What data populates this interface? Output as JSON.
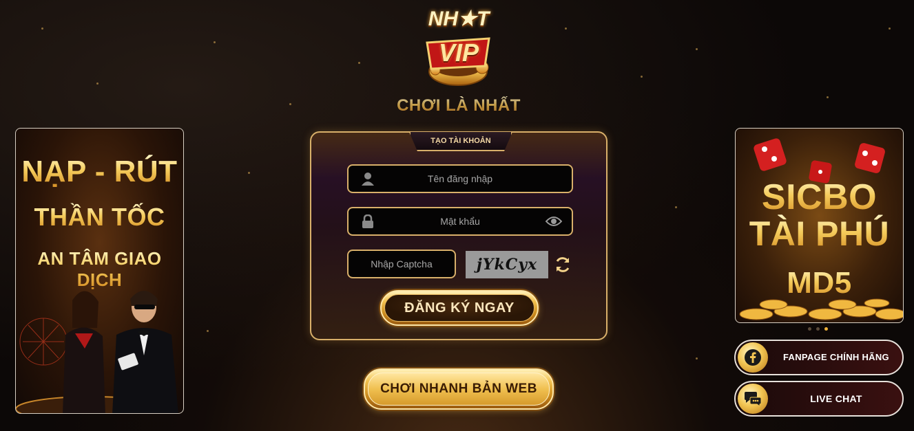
{
  "brand": {
    "logo_text_top": "NH★T",
    "logo_text_bottom": "VIP",
    "tagline": "CHƠI LÀ NHẤT"
  },
  "banner_left": {
    "line1": "NẠP - RÚT",
    "line2": "THẦN TỐC",
    "line3": "AN TÂM GIAO DỊCH"
  },
  "banner_right": {
    "line1": "SICBO",
    "line2": "TÀI PHÚ",
    "line3": "MD5"
  },
  "carousel": {
    "total": 3,
    "active": 3
  },
  "register": {
    "tab_label": "TẠO TÀI KHOẢN",
    "username_placeholder": "Tên đăng nhập",
    "password_placeholder": "Mật khẩu",
    "captcha_placeholder": "Nhập Captcha",
    "captcha_code": "jYkCyx",
    "submit_label": "ĐĂNG KÝ NGAY"
  },
  "play_web_label": "CHƠI NHANH BẢN WEB",
  "social": {
    "fanpage_label": "FANPAGE CHÍNH HÃNG",
    "livechat_label": "LIVE CHAT"
  },
  "icons": [
    "user-icon",
    "lock-icon",
    "eye-icon",
    "refresh-icon",
    "facebook-icon",
    "chat-icon"
  ],
  "colors": {
    "gold": "#d9b06a",
    "accent": "#f2c14e",
    "bg": "#0a0707"
  }
}
